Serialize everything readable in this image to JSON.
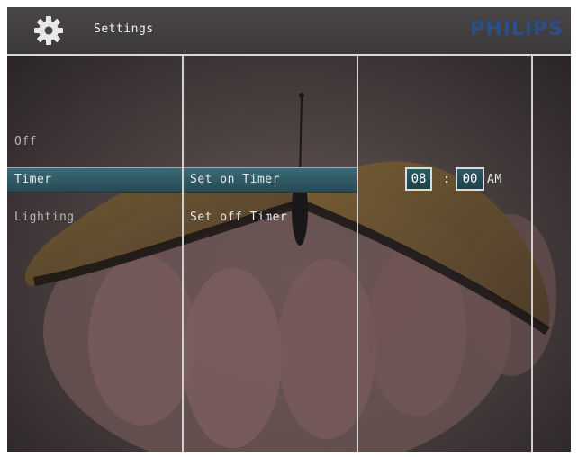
{
  "header": {
    "title": "Settings",
    "brand": "PHILIPS",
    "icon": "gear-icon"
  },
  "menu": {
    "col1": [
      {
        "label": "Off",
        "selected": false
      },
      {
        "label": "Timer",
        "selected": true
      },
      {
        "label": "Lighting",
        "selected": false
      }
    ],
    "col2": [
      {
        "label": "Set on Timer",
        "selected": true
      },
      {
        "label": "Set off Timer",
        "selected": false
      }
    ]
  },
  "timer": {
    "hour": "08",
    "separator": ":",
    "minute": "00",
    "ampm": "AM"
  },
  "colors": {
    "accent": "#2f5965",
    "brand": "#2a4f8a",
    "highlight": "#3b6a76"
  }
}
